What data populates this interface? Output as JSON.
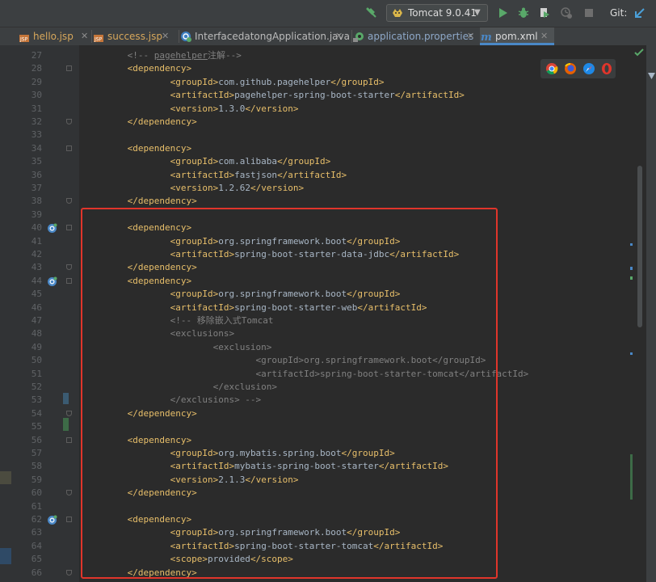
{
  "toolbar": {
    "hammer_icon": "build-hammer-icon",
    "run_config": "Tomcat 9.0.41",
    "git_label": "Git:"
  },
  "tabs": [
    {
      "label": "hello.jsp",
      "icon": "jsp-file-icon",
      "active": false
    },
    {
      "label": "success.jsp",
      "icon": "jsp-file-icon",
      "active": false
    },
    {
      "label": "InterfacedatongApplication.java",
      "icon": "spring-boot-class-icon",
      "active": false
    },
    {
      "label": "application.properties",
      "icon": "properties-file-icon",
      "active": false
    },
    {
      "label": "pom.xml",
      "icon": "maven-m-icon",
      "active": true
    }
  ],
  "colors": {
    "tag": "#e8bf6a",
    "text": "#a9b7c6",
    "comment": "#808080",
    "highlight_border": "#e0352b",
    "line_number": "#606366"
  },
  "browser_icons": [
    "chrome-icon",
    "firefox-icon",
    "safari-icon",
    "opera-icon"
  ],
  "editor": {
    "lines": [
      {
        "n": "27",
        "indent": "    ",
        "parts": [
          [
            "cm",
            "<!-- "
          ],
          [
            "cmu",
            "pagehelper"
          ],
          [
            "cm",
            "注解-->"
          ]
        ]
      },
      {
        "n": "28",
        "indent": "    ",
        "parts": [
          [
            "tag",
            "<dependency>"
          ]
        ]
      },
      {
        "n": "29",
        "indent": "        ",
        "parts": [
          [
            "tag",
            "<groupId>"
          ],
          [
            "txt",
            "com.github.pagehelper"
          ],
          [
            "tag",
            "</groupId>"
          ]
        ]
      },
      {
        "n": "30",
        "indent": "        ",
        "parts": [
          [
            "tag",
            "<artifactId>"
          ],
          [
            "txt",
            "pagehelper-spring-boot-starter"
          ],
          [
            "tag",
            "</artifactId>"
          ]
        ]
      },
      {
        "n": "31",
        "indent": "        ",
        "parts": [
          [
            "tag",
            "<version>"
          ],
          [
            "txt",
            "1.3.0"
          ],
          [
            "tag",
            "</version>"
          ]
        ]
      },
      {
        "n": "32",
        "indent": "    ",
        "parts": [
          [
            "tag",
            "</dependency>"
          ]
        ]
      },
      {
        "n": "33",
        "indent": "",
        "parts": []
      },
      {
        "n": "34",
        "indent": "    ",
        "parts": [
          [
            "tag",
            "<dependency>"
          ]
        ]
      },
      {
        "n": "35",
        "indent": "        ",
        "parts": [
          [
            "tag",
            "<groupId>"
          ],
          [
            "txt",
            "com.alibaba"
          ],
          [
            "tag",
            "</groupId>"
          ]
        ]
      },
      {
        "n": "36",
        "indent": "        ",
        "parts": [
          [
            "tag",
            "<artifactId>"
          ],
          [
            "txt",
            "fastjson"
          ],
          [
            "tag",
            "</artifactId>"
          ]
        ]
      },
      {
        "n": "37",
        "indent": "        ",
        "parts": [
          [
            "tag",
            "<version>"
          ],
          [
            "txt",
            "1.2.62"
          ],
          [
            "tag",
            "</version>"
          ]
        ]
      },
      {
        "n": "38",
        "indent": "    ",
        "parts": [
          [
            "tag",
            "</dependency>"
          ]
        ]
      },
      {
        "n": "39",
        "indent": "",
        "parts": []
      },
      {
        "n": "40",
        "indent": "    ",
        "parts": [
          [
            "tag",
            "<dependency>"
          ]
        ]
      },
      {
        "n": "41",
        "indent": "        ",
        "parts": [
          [
            "tag",
            "<groupId>"
          ],
          [
            "txt",
            "org.springframework.boot"
          ],
          [
            "tag",
            "</groupId>"
          ]
        ]
      },
      {
        "n": "42",
        "indent": "        ",
        "parts": [
          [
            "tag",
            "<artifactId>"
          ],
          [
            "txt",
            "spring-boot-starter-data-jdbc"
          ],
          [
            "tag",
            "</artifactId>"
          ]
        ]
      },
      {
        "n": "43",
        "indent": "    ",
        "parts": [
          [
            "tag",
            "</dependency>"
          ]
        ]
      },
      {
        "n": "44",
        "indent": "    ",
        "parts": [
          [
            "tag",
            "<dependency>"
          ]
        ]
      },
      {
        "n": "45",
        "indent": "        ",
        "parts": [
          [
            "tag",
            "<groupId>"
          ],
          [
            "txt",
            "org.springframework.boot"
          ],
          [
            "tag",
            "</groupId>"
          ]
        ]
      },
      {
        "n": "46",
        "indent": "        ",
        "parts": [
          [
            "tag",
            "<artifactId>"
          ],
          [
            "txt",
            "spring-boot-starter-web"
          ],
          [
            "tag",
            "</artifactId>"
          ]
        ]
      },
      {
        "n": "47",
        "indent": "        ",
        "parts": [
          [
            "cm",
            "<!-- 移除嵌入式Tomcat"
          ]
        ]
      },
      {
        "n": "48",
        "indent": "        ",
        "parts": [
          [
            "cm",
            "<exclusions>"
          ]
        ]
      },
      {
        "n": "49",
        "indent": "            ",
        "parts": [
          [
            "cm",
            "<exclusion>"
          ]
        ]
      },
      {
        "n": "50",
        "indent": "                ",
        "parts": [
          [
            "cm",
            "<groupId>org.springframework.boot</groupId>"
          ]
        ]
      },
      {
        "n": "51",
        "indent": "                ",
        "parts": [
          [
            "cm",
            "<artifactId>spring-boot-starter-tomcat</artifactId>"
          ]
        ]
      },
      {
        "n": "52",
        "indent": "            ",
        "parts": [
          [
            "cm",
            "</exclusion>"
          ]
        ]
      },
      {
        "n": "53",
        "indent": "        ",
        "parts": [
          [
            "cm",
            "</exclusions> -->"
          ]
        ]
      },
      {
        "n": "54",
        "indent": "    ",
        "parts": [
          [
            "tag",
            "</dependency>"
          ]
        ]
      },
      {
        "n": "55",
        "indent": "",
        "parts": []
      },
      {
        "n": "56",
        "indent": "    ",
        "parts": [
          [
            "tag",
            "<dependency>"
          ]
        ]
      },
      {
        "n": "57",
        "indent": "        ",
        "parts": [
          [
            "tag",
            "<groupId>"
          ],
          [
            "txt",
            "org.mybatis.spring.boot"
          ],
          [
            "tag",
            "</groupId>"
          ]
        ]
      },
      {
        "n": "58",
        "indent": "        ",
        "parts": [
          [
            "tag",
            "<artifactId>"
          ],
          [
            "txt",
            "mybatis-spring-boot-starter"
          ],
          [
            "tag",
            "</artifactId>"
          ]
        ]
      },
      {
        "n": "59",
        "indent": "        ",
        "parts": [
          [
            "tag",
            "<version>"
          ],
          [
            "txt",
            "2.1.3"
          ],
          [
            "tag",
            "</version>"
          ]
        ]
      },
      {
        "n": "60",
        "indent": "    ",
        "parts": [
          [
            "tag",
            "</dependency>"
          ]
        ]
      },
      {
        "n": "61",
        "indent": "",
        "parts": []
      },
      {
        "n": "62",
        "indent": "    ",
        "parts": [
          [
            "tag",
            "<dependency>"
          ]
        ]
      },
      {
        "n": "63",
        "indent": "        ",
        "parts": [
          [
            "tag",
            "<groupId>"
          ],
          [
            "txt",
            "org.springframework.boot"
          ],
          [
            "tag",
            "</groupId>"
          ]
        ]
      },
      {
        "n": "64",
        "indent": "        ",
        "parts": [
          [
            "tag",
            "<artifactId>"
          ],
          [
            "txt",
            "spring-boot-starter-tomcat"
          ],
          [
            "tag",
            "</artifactId>"
          ]
        ]
      },
      {
        "n": "65",
        "indent": "        ",
        "parts": [
          [
            "tag",
            "<scope>"
          ],
          [
            "txt",
            "provided"
          ],
          [
            "tag",
            "</scope>"
          ]
        ]
      },
      {
        "n": "66",
        "indent": "    ",
        "parts": [
          [
            "tag",
            "</dependency>"
          ]
        ]
      }
    ],
    "boot_icon_lines": [
      "40",
      "44",
      "62"
    ]
  }
}
